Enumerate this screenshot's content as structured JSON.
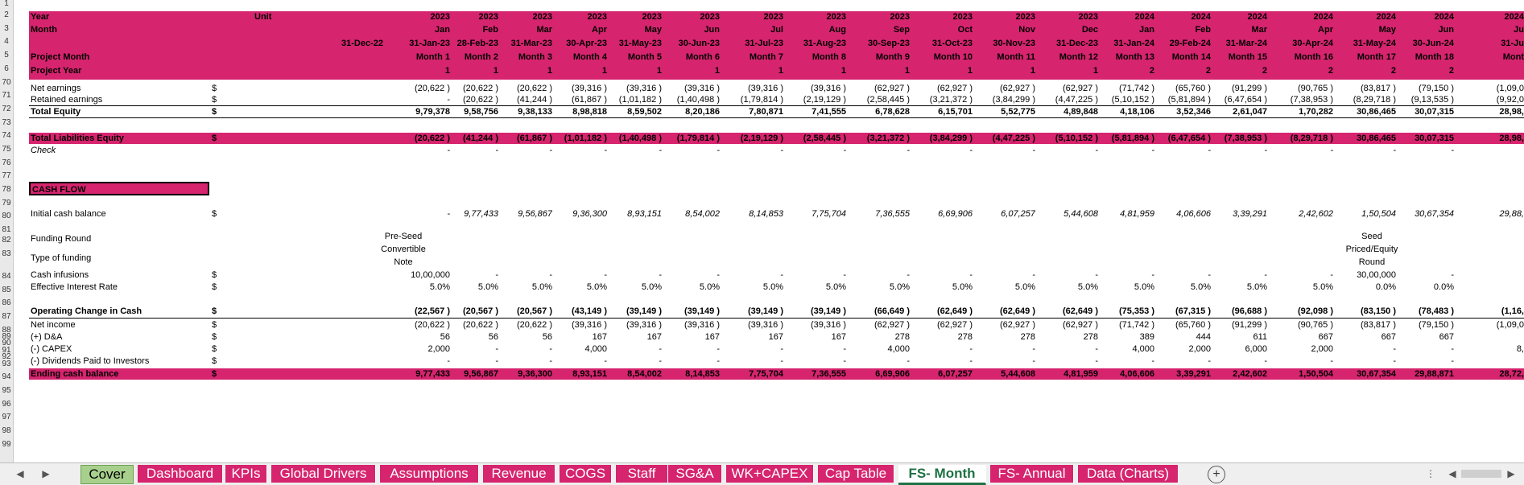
{
  "row_numbers": [
    "1",
    "2",
    "3",
    "4",
    "5",
    "6",
    "70",
    "71",
    "72",
    "73",
    "74",
    "75",
    "76",
    "77",
    "78",
    "79",
    "80",
    "81",
    "82",
    "83",
    "84",
    "85",
    "86",
    "87",
    "88",
    "89",
    "90",
    "91",
    "92",
    "93",
    "94",
    "95",
    "96",
    "97",
    "98",
    "99"
  ],
  "header": {
    "year_label": "Year",
    "unit_label": "Unit",
    "month_label": "Month",
    "start_date": "31-Dec-22",
    "project_month_label": "Project Month",
    "project_year_label": "Project Year",
    "years": [
      "2023",
      "2023",
      "2023",
      "2023",
      "2023",
      "2023",
      "2023",
      "2023",
      "2023",
      "2023",
      "2023",
      "2023",
      "2024",
      "2024",
      "2024",
      "2024",
      "2024",
      "2024",
      "2024"
    ],
    "months": [
      "Jan",
      "Feb",
      "Mar",
      "Apr",
      "May",
      "Jun",
      "Jul",
      "Aug",
      "Sep",
      "Oct",
      "Nov",
      "Dec",
      "Jan",
      "Feb",
      "Mar",
      "Apr",
      "May",
      "Jun",
      "Ju"
    ],
    "dates": [
      "31-Jan-23",
      "28-Feb-23",
      "31-Mar-23",
      "30-Apr-23",
      "31-May-23",
      "30-Jun-23",
      "31-Jul-23",
      "31-Aug-23",
      "30-Sep-23",
      "31-Oct-23",
      "30-Nov-23",
      "31-Dec-23",
      "31-Jan-24",
      "29-Feb-24",
      "31-Mar-24",
      "30-Apr-24",
      "31-May-24",
      "30-Jun-24",
      "31-Ju"
    ],
    "project_months": [
      "Month 1",
      "Month 2",
      "Month 3",
      "Month 4",
      "Month 5",
      "Month 6",
      "Month 7",
      "Month 8",
      "Month 9",
      "Month 10",
      "Month 11",
      "Month 12",
      "Month 13",
      "Month 14",
      "Month 15",
      "Month 16",
      "Month 17",
      "Month 18",
      "Mont"
    ],
    "project_years": [
      "1",
      "1",
      "1",
      "1",
      "1",
      "1",
      "1",
      "1",
      "1",
      "1",
      "1",
      "1",
      "2",
      "2",
      "2",
      "2",
      "2",
      "2",
      ""
    ]
  },
  "rows": {
    "net_earnings": {
      "label": "Net earnings",
      "unit": "$",
      "values": [
        "(20,622 )",
        "(20,622 )",
        "(20,622 )",
        "(39,316 )",
        "(39,316 )",
        "(39,316 )",
        "(39,316 )",
        "(39,316 )",
        "(62,927 )",
        "(62,927 )",
        "(62,927 )",
        "(62,927 )",
        "(71,742 )",
        "(65,760 )",
        "(91,299 )",
        "(90,765 )",
        "(83,817 )",
        "(79,150 )",
        "(1,09,0"
      ]
    },
    "retained_earnings": {
      "label": "Retained earnings",
      "unit": "$",
      "values": [
        "-",
        "(20,622 )",
        "(41,244 )",
        "(61,867 )",
        "(1,01,182 )",
        "(1,40,498 )",
        "(1,79,814 )",
        "(2,19,129 )",
        "(2,58,445 )",
        "(3,21,372 )",
        "(3,84,299 )",
        "(4,47,225 )",
        "(5,10,152 )",
        "(5,81,894 )",
        "(6,47,654 )",
        "(7,38,953 )",
        "(8,29,718 )",
        "(9,13,535 )",
        "(9,92,0"
      ]
    },
    "total_equity": {
      "label": "Total Equity",
      "unit": "$",
      "values": [
        "9,79,378",
        "9,58,756",
        "9,38,133",
        "8,98,818",
        "8,59,502",
        "8,20,186",
        "7,80,871",
        "7,41,555",
        "6,78,628",
        "6,15,701",
        "5,52,775",
        "4,89,848",
        "4,18,106",
        "3,52,346",
        "2,61,047",
        "1,70,282",
        "30,86,465",
        "30,07,315",
        "28,98,"
      ]
    },
    "total_liab_equity": {
      "label": "Total Liabilities Equity",
      "unit": "$",
      "values": [
        "(20,622 )",
        "(41,244 )",
        "(61,867 )",
        "(1,01,182 )",
        "(1,40,498 )",
        "(1,79,814 )",
        "(2,19,129 )",
        "(2,58,445 )",
        "(3,21,372 )",
        "(3,84,299 )",
        "(4,47,225 )",
        "(5,10,152 )",
        "(5,81,894 )",
        "(6,47,654 )",
        "(7,38,953 )",
        "(8,29,718 )",
        "30,86,465",
        "30,07,315",
        "28,98,"
      ]
    },
    "check": {
      "label": "Check",
      "unit": "",
      "values": [
        "-",
        "-",
        "-",
        "-",
        "-",
        "-",
        "-",
        "-",
        "-",
        "-",
        "-",
        "-",
        "-",
        "-",
        "-",
        "-",
        "-",
        "-",
        ""
      ]
    },
    "cash_flow_title": "CASH FLOW",
    "initial_cash": {
      "label": "Initial cash balance",
      "unit": "$",
      "values": [
        "-",
        "9,77,433",
        "9,56,867",
        "9,36,300",
        "8,93,151",
        "8,54,002",
        "8,14,853",
        "7,75,704",
        "7,36,555",
        "6,69,906",
        "6,07,257",
        "5,44,608",
        "4,81,959",
        "4,06,606",
        "3,39,291",
        "2,42,602",
        "1,50,504",
        "30,67,354",
        "29,88,"
      ]
    },
    "funding_round": {
      "label": "Funding Round",
      "unit": ""
    },
    "type_of_funding": {
      "label": "Type of funding",
      "unit": ""
    },
    "pre_seed_lines": [
      "Pre-Seed",
      "Convertible",
      "Note"
    ],
    "seed_lines": [
      "Seed",
      "Priced/Equity",
      "Round"
    ],
    "cash_infusions": {
      "label": "Cash infusions",
      "unit": "$",
      "values": [
        "10,00,000",
        "-",
        "-",
        "-",
        "-",
        "-",
        "-",
        "-",
        "-",
        "-",
        "-",
        "-",
        "-",
        "-",
        "-",
        "-",
        "30,00,000",
        "-",
        ""
      ]
    },
    "effective_rate": {
      "label": "Effective Interest Rate",
      "unit": "$",
      "values": [
        "5.0%",
        "5.0%",
        "5.0%",
        "5.0%",
        "5.0%",
        "5.0%",
        "5.0%",
        "5.0%",
        "5.0%",
        "5.0%",
        "5.0%",
        "5.0%",
        "5.0%",
        "5.0%",
        "5.0%",
        "5.0%",
        "0.0%",
        "0.0%",
        ""
      ]
    },
    "op_change": {
      "label": "Operating Change in Cash",
      "unit": "$",
      "values": [
        "(22,567 )",
        "(20,567 )",
        "(20,567 )",
        "(43,149 )",
        "(39,149 )",
        "(39,149 )",
        "(39,149 )",
        "(39,149 )",
        "(66,649 )",
        "(62,649 )",
        "(62,649 )",
        "(62,649 )",
        "(75,353 )",
        "(67,315 )",
        "(96,688 )",
        "(92,098 )",
        "(83,150 )",
        "(78,483 )",
        "(1,16,"
      ]
    },
    "net_income": {
      "label": "Net income",
      "unit": "$",
      "values": [
        "(20,622 )",
        "(20,622 )",
        "(20,622 )",
        "(39,316 )",
        "(39,316 )",
        "(39,316 )",
        "(39,316 )",
        "(39,316 )",
        "(62,927 )",
        "(62,927 )",
        "(62,927 )",
        "(62,927 )",
        "(71,742 )",
        "(65,760 )",
        "(91,299 )",
        "(90,765 )",
        "(83,817 )",
        "(79,150 )",
        "(1,09,0"
      ]
    },
    "da": {
      "label": "(+) D&A",
      "unit": "$",
      "values": [
        "56",
        "56",
        "56",
        "167",
        "167",
        "167",
        "167",
        "167",
        "278",
        "278",
        "278",
        "278",
        "389",
        "444",
        "611",
        "667",
        "667",
        "667",
        ""
      ]
    },
    "capex": {
      "label": "(-) CAPEX",
      "unit": "$",
      "values": [
        "2,000",
        "-",
        "-",
        "4,000",
        "-",
        "-",
        "-",
        "-",
        "4,000",
        "-",
        "-",
        "-",
        "4,000",
        "2,000",
        "6,000",
        "2,000",
        "-",
        "-",
        "8,"
      ]
    },
    "dividends": {
      "label": "(-) Dividends Paid to Investors",
      "unit": "$",
      "values": [
        "-",
        "-",
        "-",
        "-",
        "-",
        "-",
        "-",
        "-",
        "-",
        "-",
        "-",
        "-",
        "-",
        "-",
        "-",
        "-",
        "-",
        "-",
        ""
      ]
    },
    "ending_cash": {
      "label": "Ending cash balance",
      "unit": "$",
      "values": [
        "9,77,433",
        "9,56,867",
        "9,36,300",
        "8,93,151",
        "8,54,002",
        "8,14,853",
        "7,75,704",
        "7,36,555",
        "6,69,906",
        "6,07,257",
        "5,44,608",
        "4,81,959",
        "4,06,606",
        "3,39,291",
        "2,42,602",
        "1,50,504",
        "30,67,354",
        "29,88,871",
        "28,72,"
      ]
    }
  },
  "tabs": [
    {
      "label": "Cover",
      "kind": "cover"
    },
    {
      "label": "Dashboard",
      "kind": "normal"
    },
    {
      "label": "KPIs",
      "kind": "normal"
    },
    {
      "label": "Global Drivers",
      "kind": "normal"
    },
    {
      "label": "Assumptions",
      "kind": "normal"
    },
    {
      "label": "Revenue",
      "kind": "normal"
    },
    {
      "label": "COGS",
      "kind": "normal"
    },
    {
      "label": "Staff",
      "kind": "normal"
    },
    {
      "label": "SG&A",
      "kind": "normal"
    },
    {
      "label": "WK+CAPEX",
      "kind": "normal"
    },
    {
      "label": "Cap Table",
      "kind": "normal"
    },
    {
      "label": "FS- Month",
      "kind": "active"
    },
    {
      "label": "FS- Annual",
      "kind": "normal"
    },
    {
      "label": "Data (Charts)",
      "kind": "normal"
    }
  ],
  "nav": {
    "prev": "◀",
    "next": "▶",
    "add": "+",
    "more": "⋮"
  },
  "colors": {
    "pink": "#d6246e",
    "cover": "#a8d08d",
    "active_text": "#1e7145"
  }
}
